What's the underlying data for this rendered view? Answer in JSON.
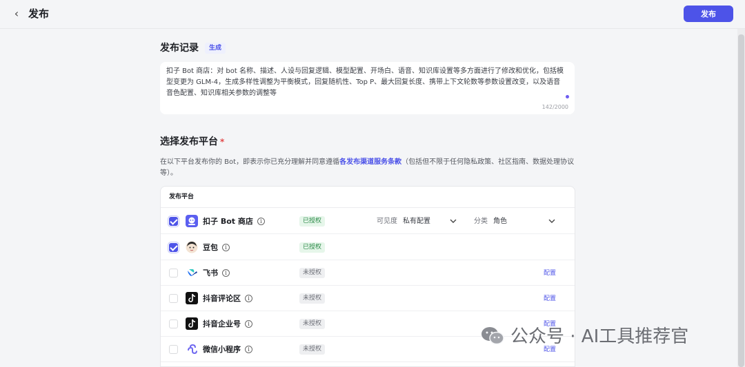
{
  "header": {
    "back_glyph": "‹",
    "title": "发布",
    "publish_label": "发布"
  },
  "record": {
    "title": "发布记录",
    "generate_label": "生成",
    "text": "扣子 Bot 商店：对 bot 名称、描述、人设与回复逻辑、模型配置、开场白、语音、知识库设置等多方面进行了修改和优化，包括模型变更为 GLM-4，生成多样性调整为平衡模式，回复随机性、Top P、最大回复长度、携带上下文轮数等参数设置改变，以及语音音色配置、知识库相关参数的调整等",
    "char_count": "142/2000"
  },
  "platform": {
    "title": "选择发布平台",
    "required_mark": "*",
    "desc_before": "在以下平台发布你的 Bot，即表示你已充分理解并同意遵循",
    "desc_link": "各发布渠道服务条款",
    "desc_after": "（包括但不限于任何隐私政策、社区指南、数据处理协议等）。",
    "table_header": "发布平台",
    "rows": [
      {
        "name": "扣子 Bot 商店",
        "status": "已授权",
        "checked": true,
        "visibility_label": "可见度",
        "visibility_value": "私有配置",
        "category_label": "分类",
        "category_value": "角色"
      },
      {
        "name": "豆包",
        "status": "已授权",
        "checked": true
      },
      {
        "name": "飞书",
        "status": "未授权",
        "checked": false,
        "config": "配置"
      },
      {
        "name": "抖音评论区",
        "status": "未授权",
        "checked": false,
        "config": "配置"
      },
      {
        "name": "抖音企业号",
        "status": "未授权",
        "checked": false,
        "config": "配置"
      },
      {
        "name": "微信小程序",
        "status": "未授权",
        "checked": false,
        "config": "配置"
      }
    ]
  },
  "icons": {
    "info": "info-icon",
    "chevron": "chevron-down-icon"
  },
  "watermark": "公众号 · AI工具推荐官",
  "colors": {
    "accent": "#4d53e8",
    "authorized_text": "#2e8b4a",
    "authorized_bg": "#e6f6ea"
  }
}
